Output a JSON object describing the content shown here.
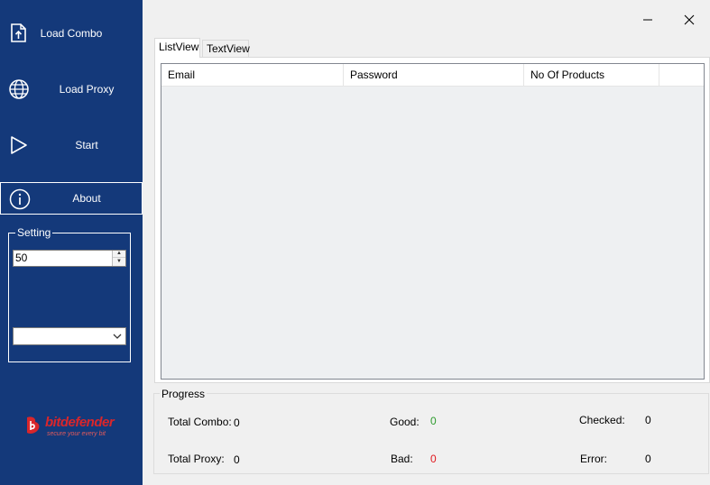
{
  "sidebar": {
    "nav": [
      {
        "label": "Load Combo",
        "icon": "upload-file-icon"
      },
      {
        "label": "Load Proxy",
        "icon": "globe-icon"
      },
      {
        "label": "Start",
        "icon": "play-icon"
      },
      {
        "label": "About",
        "icon": "info-icon"
      }
    ],
    "setting": {
      "legend": "Setting",
      "threads_value": "50",
      "dropdown_value": ""
    },
    "logo": {
      "wordmark_bit": "bit",
      "wordmark_defender": "defender",
      "tagline": "secure your every bit"
    }
  },
  "tabs": [
    {
      "label": "ListView",
      "selected": true
    },
    {
      "label": "TextView",
      "selected": false
    }
  ],
  "list": {
    "columns": [
      "Email",
      "Password",
      "No Of Products"
    ],
    "rows": []
  },
  "progress": {
    "legend": "Progress",
    "total_combo_label": "Total Combo:",
    "total_combo_value": "0",
    "total_proxy_label": "Total Proxy:",
    "total_proxy_value": "0",
    "good_label": "Good:",
    "good_value": "0",
    "bad_label": "Bad:",
    "bad_value": "0",
    "checked_label": "Checked:",
    "checked_value": "0",
    "error_label": "Error:",
    "error_value": "0"
  },
  "colors": {
    "sidebar_bg": "#14397a",
    "good": "#2e9c2e",
    "bad": "#e0191f",
    "brand_red": "#d9262b"
  }
}
